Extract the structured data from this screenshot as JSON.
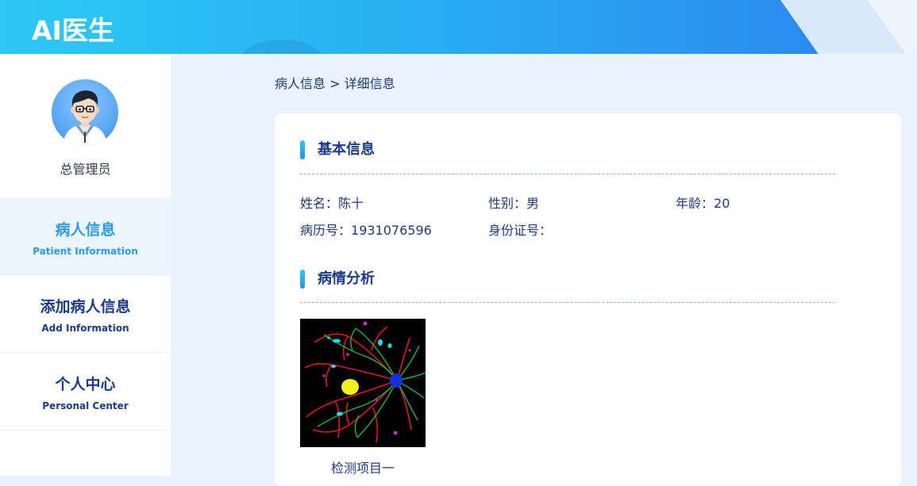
{
  "header": {
    "title": "AI医生"
  },
  "sidebar": {
    "profile": {
      "name": "总管理员"
    },
    "items": [
      {
        "label": "病人信息",
        "sublabel": "Patient Information",
        "active": true
      },
      {
        "label": "添加病人信息",
        "sublabel": "Add Information",
        "active": false
      },
      {
        "label": "个人中心",
        "sublabel": "Personal Center",
        "active": false
      }
    ]
  },
  "breadcrumb": {
    "text": "病人信息 > 详细信息"
  },
  "basic_info": {
    "title": "基本信息",
    "name_label": "姓名：",
    "name_value": "陈十",
    "gender_label": "性别：",
    "gender_value": "男",
    "age_label": "年龄：",
    "age_value": "20",
    "record_label": "病历号：",
    "record_value": "1931076596",
    "id_label": "身份证号：",
    "id_value": ""
  },
  "analysis": {
    "title": "病情分析",
    "items": [
      {
        "caption": "检测项目一"
      }
    ]
  },
  "colors": {
    "accent": "#2b9af3",
    "nav_text": "#1a3a8a",
    "body_text": "#1f3b7a",
    "page_bg": "#eaf2fd"
  }
}
